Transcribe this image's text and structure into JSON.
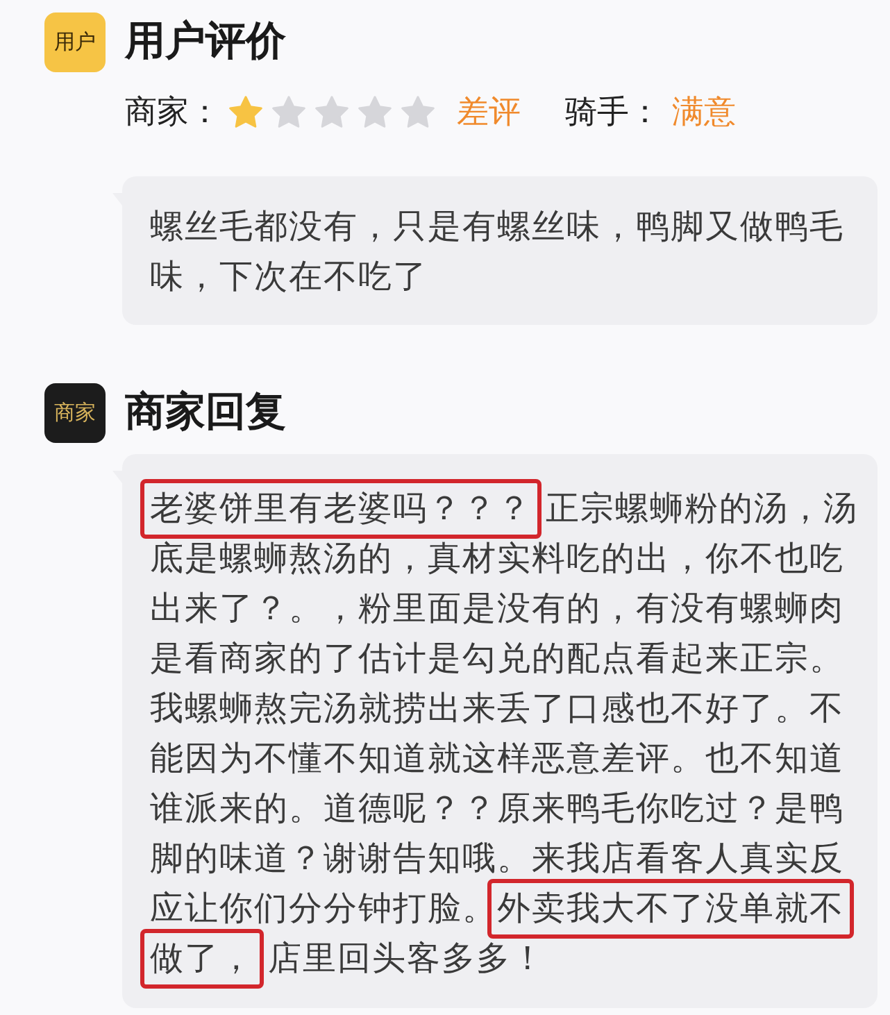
{
  "user_review": {
    "badge": "用户",
    "title": "用户评价",
    "ratings": [
      {
        "kind": "stars",
        "label": "商家：",
        "stars": 1,
        "verdict": "差评"
      },
      {
        "kind": "plain",
        "label": "骑手：",
        "verdict": "满意"
      }
    ],
    "comment": "螺丝毛都没有，只是有螺丝味，鸭脚又做鸭毛味，下次在不吃了"
  },
  "merchant_reply": {
    "badge": "商家",
    "title": "商家回复",
    "segments": [
      {
        "text": "老婆饼里有老婆吗？？？",
        "highlighted": true
      },
      {
        "text": "正宗螺蛳粉的汤，汤底是螺蛳熬汤的，真材实料吃的出，你不也吃出来了？。，粉里面是没有的，有没有螺蛳肉是看商家的了估计是勾兑的配点看起来正宗。我螺蛳熬完汤就捞出来丢了口感也不好了。不能因为不懂不知道就这样恶意差评。也不知道谁派来的。道德呢？？原来鸭毛你吃过？是鸭脚的味道？谢谢告知哦。来我店看客人真实反应让你们分分钟打脸。",
        "highlighted": false
      },
      {
        "text": "外卖我大不了没单就不",
        "highlighted": true
      },
      {
        "text": "做了，",
        "highlighted": true
      },
      {
        "text": "店里回头客多多！",
        "highlighted": false
      }
    ]
  }
}
